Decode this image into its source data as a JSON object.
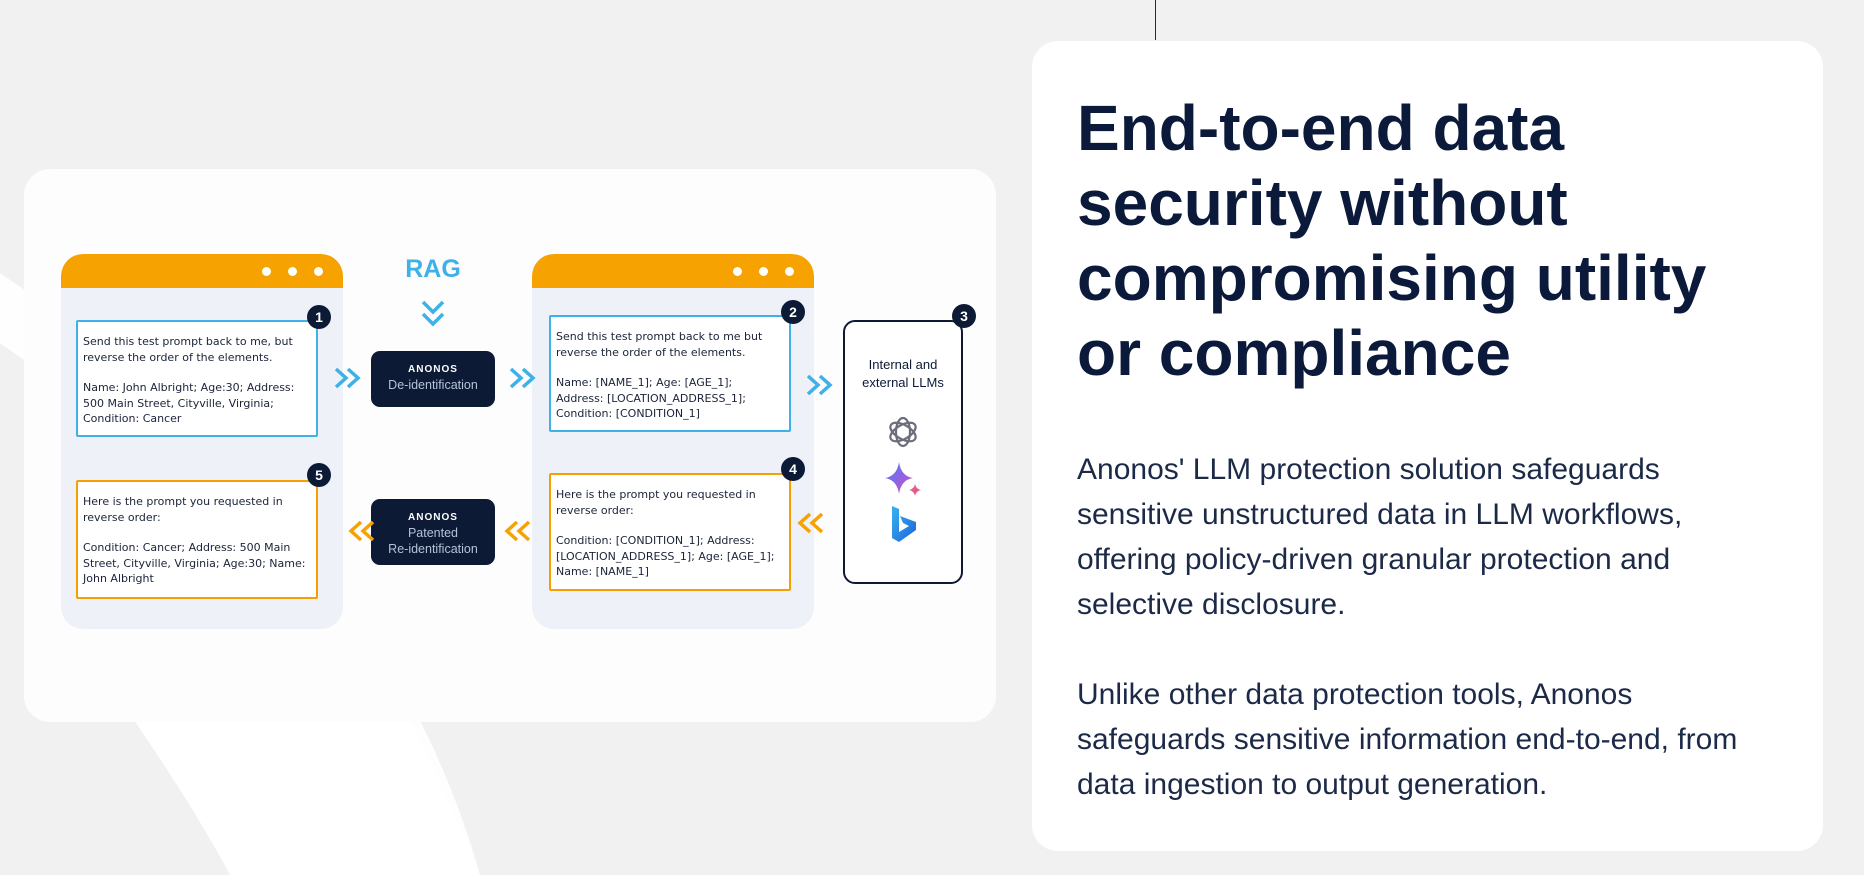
{
  "diagram": {
    "rag_label": "RAG",
    "deid": {
      "brand": "ANONOS",
      "label": "De-identification"
    },
    "reid": {
      "brand": "ANONOS",
      "label": "Patented\nRe-identification"
    },
    "llm_label": "Internal and\nexternal LLMs",
    "llm_icons": [
      "openai-icon",
      "gemini-icon",
      "bing-icon"
    ],
    "steps": [
      {
        "number": "1",
        "line1": "Send this test prompt back to me, but reverse the order of the elements.",
        "line2": "Name: John Albright; Age:30; Address: 500 Main Street, Cityville, Virginia; Condition: Cancer"
      },
      {
        "number": "2",
        "line1": "Send this test prompt back to me but reverse the order of the elements.",
        "line2": "Name: [NAME_1]; Age: [AGE_1]; Address: [LOCATION_ADDRESS_1]; Condition: [CONDITION_1]"
      },
      {
        "number": "3"
      },
      {
        "number": "4",
        "line1": "Here is the prompt you requested in reverse order:",
        "line2": "Condition: [CONDITION_1]; Address: [LOCATION_ADDRESS_1]; Age: [AGE_1]; Name: [NAME_1]"
      },
      {
        "number": "5",
        "line1": "Here is the prompt you requested in reverse order:",
        "line2": "Condition: Cancer; Address: 500 Main Street, Cityville, Virginia; Age:30; Name: John Albright"
      }
    ],
    "colors": {
      "navy": "#0c1a36",
      "blue": "#3db1e8",
      "orange": "#f6a200"
    }
  },
  "content": {
    "headline": "End-to-end data security without compromising utility or compliance",
    "paragraph1": "Anonos' LLM protection solution safeguards sensitive unstructured data in LLM workflows, offering policy-driven granular protection and selective disclosure.",
    "paragraph2": "Unlike other data protection tools, Anonos safeguards sensitive information end-to-end, from data ingestion to output generation."
  }
}
